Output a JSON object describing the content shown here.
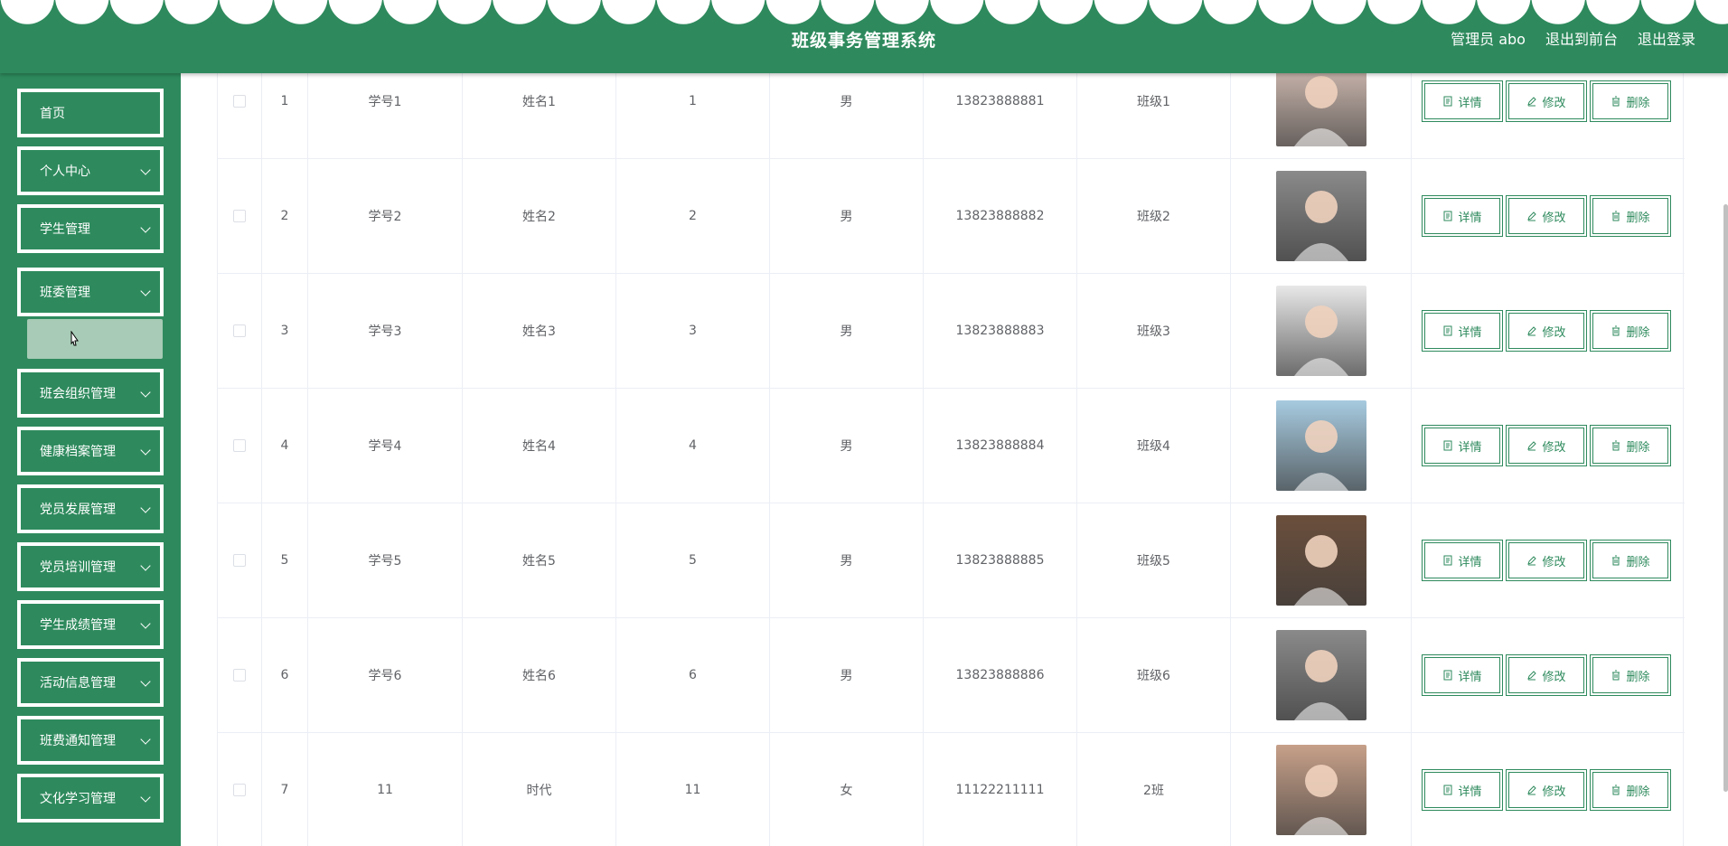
{
  "header": {
    "title": "班级事务管理系统",
    "links": [
      "管理员 abo",
      "退出到前台",
      "退出登录"
    ]
  },
  "sidebar": {
    "items": [
      {
        "label": "首页",
        "has_arrow": false
      },
      {
        "label": "个人中心",
        "has_arrow": true
      },
      {
        "label": "学生管理",
        "has_arrow": true
      },
      {
        "label": "班委管理",
        "has_arrow": true
      },
      {
        "label": "班会组织管理",
        "has_arrow": true
      },
      {
        "label": "健康档案管理",
        "has_arrow": true
      },
      {
        "label": "党员发展管理",
        "has_arrow": true
      },
      {
        "label": "党员培训管理",
        "has_arrow": true
      },
      {
        "label": "学生成绩管理",
        "has_arrow": true
      },
      {
        "label": "活动信息管理",
        "has_arrow": true
      },
      {
        "label": "班费通知管理",
        "has_arrow": true
      },
      {
        "label": "文化学习管理",
        "has_arrow": true
      }
    ]
  },
  "table": {
    "rows": [
      {
        "index": "1",
        "student_no": "学号1",
        "name": "姓名1",
        "seq": "1",
        "gender": "男",
        "phone": "13823888881",
        "class": "班级1",
        "avatar_tone": "#d8c2b8"
      },
      {
        "index": "2",
        "student_no": "学号2",
        "name": "姓名2",
        "seq": "2",
        "gender": "男",
        "phone": "13823888882",
        "class": "班级2",
        "avatar_tone": "#8a8a8a"
      },
      {
        "index": "3",
        "student_no": "学号3",
        "name": "姓名3",
        "seq": "3",
        "gender": "男",
        "phone": "13823888883",
        "class": "班级3",
        "avatar_tone": "#e8e8e8"
      },
      {
        "index": "4",
        "student_no": "学号4",
        "name": "姓名4",
        "seq": "4",
        "gender": "男",
        "phone": "13823888884",
        "class": "班级4",
        "avatar_tone": "#a7cbe0"
      },
      {
        "index": "5",
        "student_no": "学号5",
        "name": "姓名5",
        "seq": "5",
        "gender": "男",
        "phone": "13823888885",
        "class": "班级5",
        "avatar_tone": "#6b4f3c"
      },
      {
        "index": "6",
        "student_no": "学号6",
        "name": "姓名6",
        "seq": "6",
        "gender": "男",
        "phone": "13823888886",
        "class": "班级6",
        "avatar_tone": "#8a8a8a"
      },
      {
        "index": "7",
        "student_no": "11",
        "name": "时代",
        "seq": "11",
        "gender": "女",
        "phone": "11122211111",
        "class": "2班",
        "avatar_tone": "#c7a089"
      }
    ],
    "actions": {
      "detail": "详情",
      "edit": "修改",
      "delete": "删除"
    }
  },
  "colors": {
    "brand": "#2e8a5d",
    "submenu_active": "#a7cbb6"
  }
}
